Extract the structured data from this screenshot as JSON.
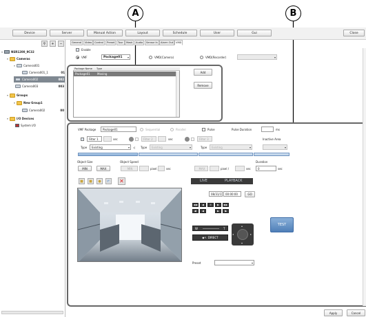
{
  "callouts": {
    "a": "A",
    "b": "B"
  },
  "topbar": {
    "device": "Device",
    "server": "Server",
    "manual_action": "Manual Action",
    "layout": "Layout",
    "schedule": "Schedule",
    "user": "User",
    "gui": "Gui",
    "close": "Close"
  },
  "tree": {
    "root": "NSR1200_9C32",
    "cameras": "Cameras",
    "camera01": "Camera001",
    "camera01_1": "Camera001_1",
    "camera01_1_num": "01",
    "camera02": "Camera002",
    "camera02_num": "002",
    "camera03": "Camera003",
    "camera03_num": "003",
    "groups": "Groups",
    "new_group": "New Group1",
    "camera02b": "Camera002",
    "camera02b_num": "00",
    "io_devices": "I/O Devices",
    "system_io": "System I/O"
  },
  "tabs": [
    "General",
    "Video",
    "Control",
    "Preset",
    "Tour",
    "Mask",
    "Audio",
    "Sensor In",
    "Alarm Out",
    "VMD"
  ],
  "vmd_top": {
    "enable": "Enable",
    "vmf_label": "VMF",
    "package_value": "Package01",
    "vmd_camera": "VMD(Camera)",
    "vmd_recorder": "VMD(Recorder)",
    "list_headers": [
      "Package Name",
      "Type"
    ],
    "list_row": [
      "Package01",
      "Moving"
    ],
    "add": "Add",
    "remove": "Remove"
  },
  "vmf": {
    "package_label": "VMF Package",
    "package_value": "Package01",
    "sequential": "Sequential",
    "parallel": "Parallel",
    "pulse": "Pulse",
    "pulse_duration": "Pulse Duration",
    "ms": "ms",
    "filter1": "Filter 1",
    "filter2": "Filter 2",
    "filter3": "Filter 3",
    "sec": "sec",
    "inactive_area": "Inactive Area",
    "type": "Type",
    "type1_value": "Existing",
    "type2_value": "Existing",
    "type3_value": "Existing",
    "object_size": "Object Size",
    "object_speed": "Object Speed",
    "min": "MIN",
    "max": "MAX",
    "min_speed": "MIN",
    "pixel_sec": "pixel /",
    "max_speed": "MAX",
    "duration": "Duration",
    "duration_value": "0",
    "live": "LIVE",
    "playback": "PLAYBACK",
    "date": "08/31/11",
    "time": "00:00:00",
    "go": "GO",
    "wide": "W",
    "tele": "T",
    "direct": "DIRECT",
    "test": "TEST",
    "preset": "Preset"
  },
  "footer": {
    "apply": "Apply",
    "cancel": "Cancel"
  },
  "colors": {
    "accent_blue": "#2f6db5",
    "live_bar": "#3a3a3a",
    "tree_selected": "#7f8891"
  }
}
